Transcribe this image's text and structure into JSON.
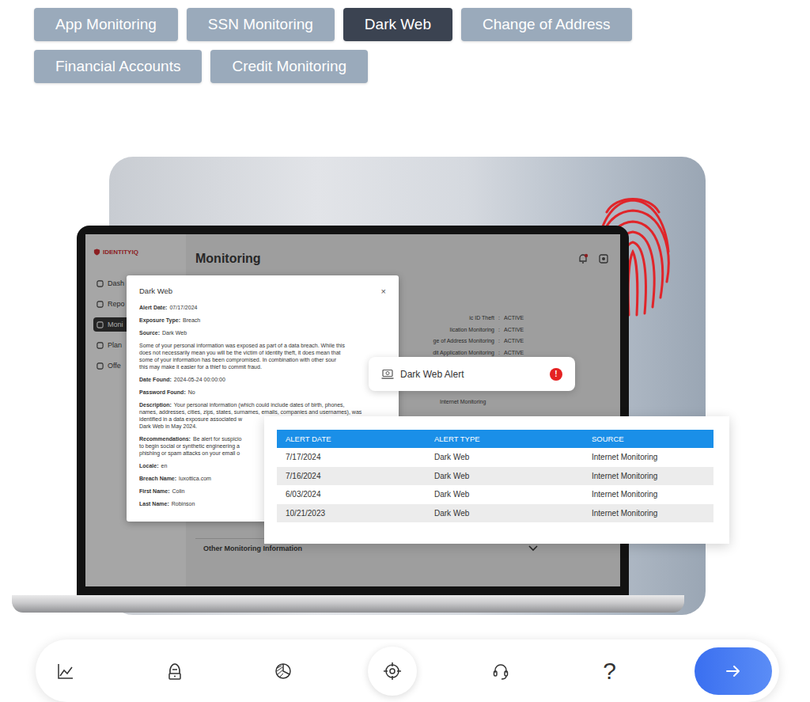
{
  "tabs": [
    {
      "label": "App Monitoring",
      "selected": false
    },
    {
      "label": "SSN Monitoring",
      "selected": false
    },
    {
      "label": "Dark Web",
      "selected": true
    },
    {
      "label": "Change of Address",
      "selected": false
    },
    {
      "label": "Financial Accounts",
      "selected": false
    },
    {
      "label": "Credit Monitoring",
      "selected": false
    }
  ],
  "app_screen": {
    "logo": "IDENTITYIQ",
    "title": "Monitoring",
    "sidebar": [
      {
        "label": "Dash",
        "selected": false
      },
      {
        "label": "Repo",
        "selected": false
      },
      {
        "label": "Moni",
        "selected": true
      },
      {
        "label": "Plan",
        "selected": false
      },
      {
        "label": "Offe",
        "selected": false
      }
    ],
    "monitoring_rows": [
      {
        "label": "ic ID Theft",
        "status": "ACTIVE"
      },
      {
        "label": "lication Monitoring",
        "status": "ACTIVE"
      },
      {
        "label": "ge of Address Monitoring",
        "status": "ACTIVE"
      },
      {
        "label": "dit Application Monitoring",
        "status": "ACTIVE"
      }
    ],
    "extra_row": "Internet Monitoring",
    "section": "Other Monitoring Information"
  },
  "modal": {
    "title": "Dark Web",
    "close": "×",
    "fields": [
      {
        "kind": "field",
        "label": "Alert Date:",
        "lines": [
          "07/17/2024"
        ]
      },
      {
        "kind": "field",
        "label": "Exposure Type:",
        "lines": [
          "Breach"
        ]
      },
      {
        "kind": "field",
        "label": "Source:",
        "lines": [
          "Dark Web"
        ]
      },
      {
        "kind": "paragraph",
        "label": "",
        "lines": [
          "Some of your personal information was exposed as part of a data breach. While this",
          "does not necessarily mean you will be the victim of identity theft, it does mean that",
          "some of your information has been compromised. In combination with other sour",
          "this may make it easier for a thief to commit fraud."
        ]
      },
      {
        "kind": "field",
        "label": "Date Found:",
        "lines": [
          "2024-05-24 00:00:00"
        ]
      },
      {
        "kind": "field",
        "label": "Password Found:",
        "lines": [
          "No"
        ]
      },
      {
        "kind": "field",
        "label": "Description:",
        "lines": [
          "Your personal information (which could include dates of birth, phones,",
          "names, addresses, cities, zips, states, surnames, emails, companies and usernames), was",
          "identified in a data exposure associated w",
          "Dark Web in May 2024."
        ]
      },
      {
        "kind": "field",
        "label": "Recommendations:",
        "lines": [
          "Be alert for suspicio",
          "to begin social or synthetic engineering a",
          "phishing or spam attacks on your email o"
        ]
      },
      {
        "kind": "field",
        "label": "Locale:",
        "lines": [
          "en"
        ]
      },
      {
        "kind": "field",
        "label": "Breach Name:",
        "lines": [
          "luxottica.com"
        ]
      },
      {
        "kind": "field",
        "label": "First Name:",
        "lines": [
          "Colin"
        ]
      },
      {
        "kind": "field",
        "label": "Last Name:",
        "lines": [
          "Robinson"
        ]
      }
    ]
  },
  "alert_pill": {
    "label": "Dark Web Alert",
    "badge": "!",
    "color": "#e52222"
  },
  "alerts_table": {
    "columns": [
      "ALERT DATE",
      "ALERT TYPE",
      "SOURCE"
    ],
    "rows": [
      [
        "7/17/2024",
        "Dark Web",
        "Internet Monitoring"
      ],
      [
        "7/16/2024",
        "Dark Web",
        "Internet Monitoring"
      ],
      [
        "6/03/2024",
        "Dark Web",
        "Internet Monitoring"
      ],
      [
        "10/21/2023",
        "Dark Web",
        "Internet Monitoring"
      ]
    ]
  },
  "nav": [
    {
      "kind": "icon",
      "label": "",
      "selected": false
    },
    {
      "kind": "icon",
      "label": "",
      "selected": false
    },
    {
      "kind": "icon",
      "label": "",
      "selected": false
    },
    {
      "kind": "icon",
      "label": "",
      "selected": true
    },
    {
      "kind": "icon",
      "label": "",
      "selected": false
    },
    {
      "kind": "text",
      "label": "?",
      "selected": false
    }
  ]
}
